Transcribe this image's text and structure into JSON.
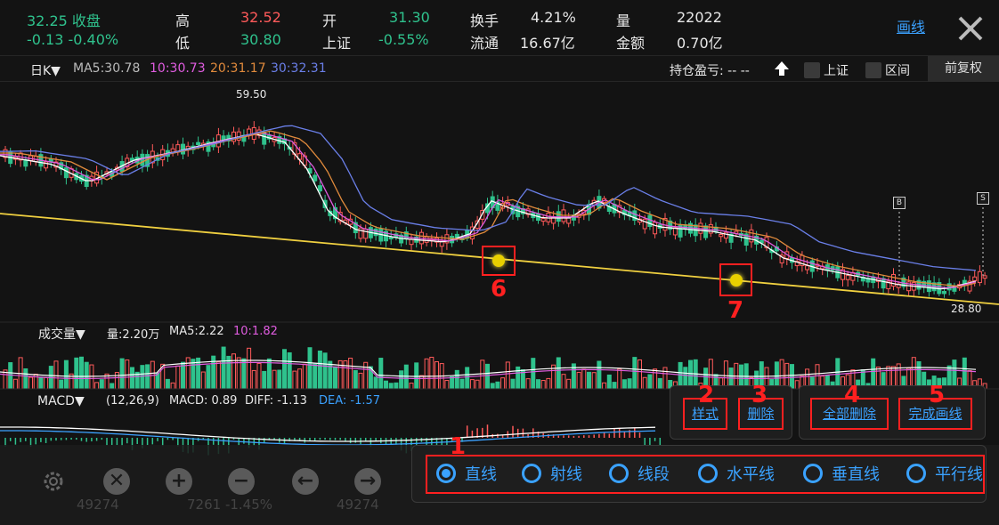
{
  "header": {
    "price": "32.25",
    "price_status": "收盘",
    "change": "-0.13",
    "change_pct": "-0.40%",
    "high_label": "高",
    "high_value": "32.52",
    "low_label": "低",
    "low_value": "30.80",
    "open_label": "开",
    "open_value": "31.30",
    "index_label": "上证",
    "index_value": "-0.55%",
    "turnover_label": "换手",
    "turnover_value": "4.21%",
    "float_label": "流通",
    "float_value": "16.67亿",
    "volume_label": "量",
    "volume_value": "22022",
    "amount_label": "金额",
    "amount_value": "0.70亿",
    "draw_link": "画线"
  },
  "infobar": {
    "period": "日K▼",
    "ma5": "MA5:30.78",
    "ma10": "10:30.73",
    "ma20": "20:31.17",
    "ma30": "30:32.31",
    "position_pl": "持仓盈亏: -- --",
    "chk_index": "上证",
    "chk_range": "区间",
    "adjust": "前复权"
  },
  "chart": {
    "max_label": "59.50",
    "min_label": "28.80",
    "signal_b": "B",
    "signal_s": "S"
  },
  "volume": {
    "title": "成交量▼",
    "vol": "量:2.20万",
    "ma5": "MA5:2.22",
    "ma10": "10:1.82"
  },
  "macd": {
    "title": "MACD▼",
    "params": "(12,26,9)",
    "macd": "MACD: 0.89",
    "diff": "DIFF: -1.13",
    "dea": "DEA: -1.57"
  },
  "bottom": {
    "faded_1": "49274",
    "faded_2": "7261 -1.45%",
    "faded_3": "49274"
  },
  "toolbar": {
    "style_btn": "样式",
    "delete_btn": "删除",
    "delete_all_btn": "全部删除",
    "finish_btn": "完成画线"
  },
  "draw_types": [
    {
      "label": "直线",
      "selected": true
    },
    {
      "label": "射线",
      "selected": false
    },
    {
      "label": "线段",
      "selected": false
    },
    {
      "label": "水平线",
      "selected": false
    },
    {
      "label": "垂直线",
      "selected": false
    },
    {
      "label": "平行线",
      "selected": false
    }
  ],
  "annotations": [
    "1",
    "2",
    "3",
    "4",
    "5",
    "6",
    "7"
  ],
  "colors": {
    "up": "#ff5a5a",
    "down": "#2fc28d",
    "ma5": "#ffffff",
    "ma10": "#e05ce0",
    "ma20": "#e08a3c",
    "ma30": "#6a7fe8",
    "trendline": "#f0d040",
    "accent": "#3aa2ff",
    "annotation": "#ff2020"
  },
  "chart_data": {
    "type": "candlestick",
    "ma_series": [
      {
        "name": "MA5",
        "last": 30.78
      },
      {
        "name": "10",
        "last": 30.73
      },
      {
        "name": "20",
        "last": 31.17
      },
      {
        "name": "30",
        "last": 32.31
      }
    ],
    "max_price": 59.5,
    "min_price": 28.8,
    "macd": {
      "macd": 0.89,
      "diff": -1.13,
      "dea": -1.57
    },
    "volume_last": "2.20万"
  }
}
